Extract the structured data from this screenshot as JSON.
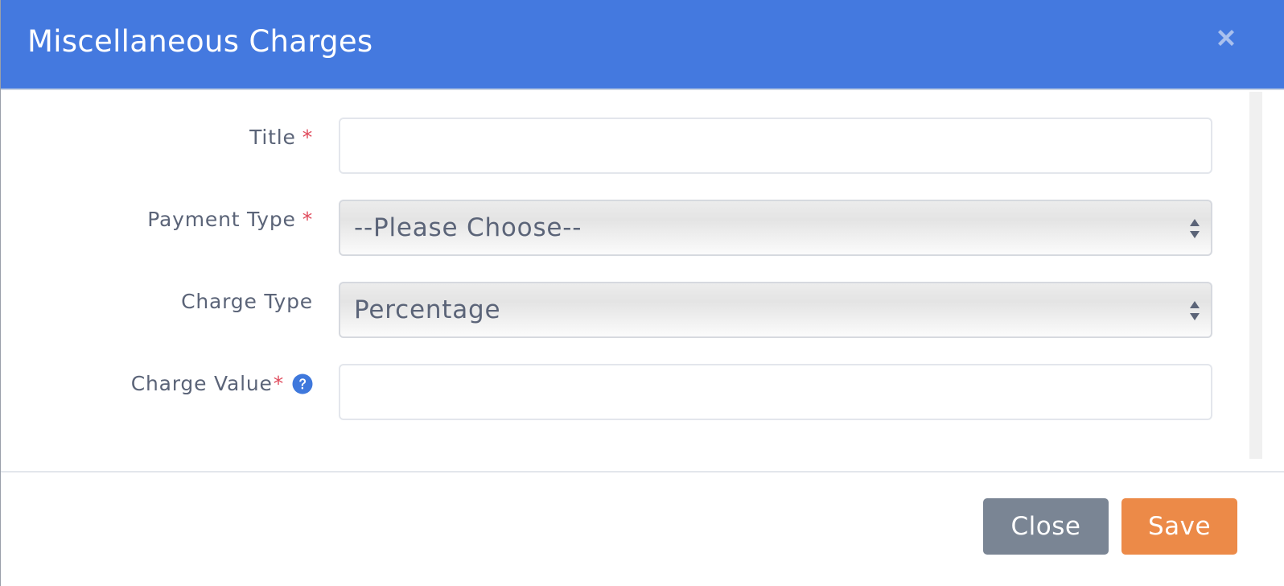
{
  "modal": {
    "title": "Miscellaneous Charges",
    "close_icon": "close-x-icon"
  },
  "form": {
    "title": {
      "label": "Title",
      "required_mark": "*",
      "value": ""
    },
    "payment_type": {
      "label": "Payment Type",
      "required_mark": "*",
      "selected": "--Please Choose--"
    },
    "charge_type": {
      "label": "Charge Type",
      "selected": "Percentage"
    },
    "charge_value": {
      "label": "Charge Value",
      "required_mark": "*",
      "help_icon": "question-circle-icon",
      "value": ""
    }
  },
  "footer": {
    "close_label": "Close",
    "save_label": "Save"
  },
  "colors": {
    "header": "#4479df",
    "required": "#e04b5c",
    "close_button": "#7a8594",
    "save_button": "#ec8a48",
    "help_icon": "#3f78dc"
  }
}
